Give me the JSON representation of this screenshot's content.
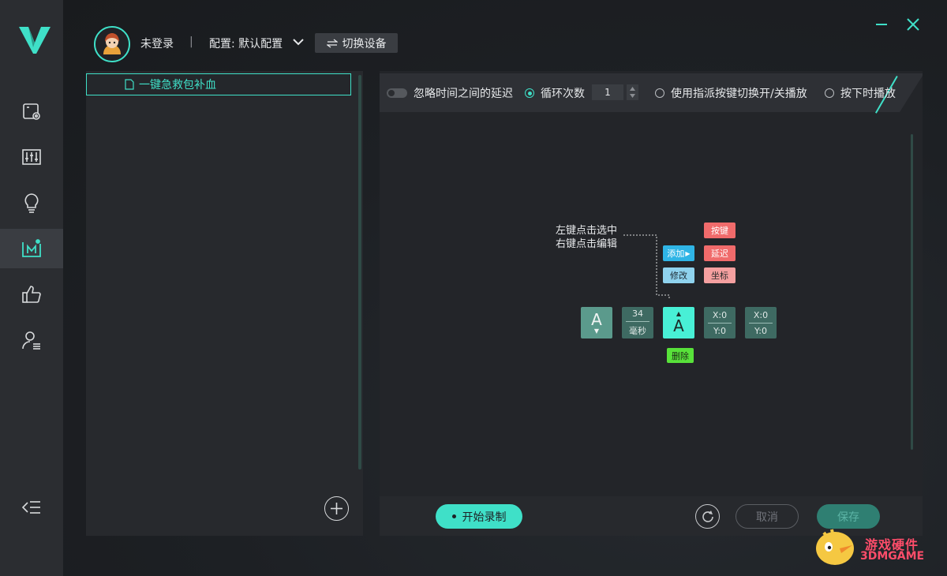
{
  "header": {
    "user_status": "未登录",
    "separator": "|",
    "config_label": "配置: 默认配置",
    "switch_device": "切换设备"
  },
  "macros": {
    "items": [
      {
        "label": "一键急救包补血"
      }
    ]
  },
  "options": {
    "ignore_delay": "忽略时间之间的延迟",
    "loop_count_label": "循环次数",
    "loop_count_value": "1",
    "toggle_by_key": "使用指派按键切换开/关播放",
    "play_while_pressed": "按下时播放"
  },
  "tutorial": {
    "hint_line1": "左键点击选中",
    "hint_line2": "右键点击编辑",
    "menu": {
      "add": "添加",
      "modify": "修改",
      "key": "按键",
      "delay": "延迟",
      "coord": "坐标",
      "delete": "删除"
    },
    "steps": {
      "key1": "A",
      "delay_value": "34",
      "delay_unit": "毫秒",
      "key2": "A",
      "coord1_x": "X:0",
      "coord1_y": "Y:0",
      "coord2_x": "X:0",
      "coord2_y": "Y:0"
    }
  },
  "footer": {
    "record": "开始录制",
    "cancel": "取消",
    "save": "保存"
  },
  "watermark": {
    "line1": "游戏硬件",
    "line2": "3DMGAME"
  },
  "colors": {
    "accent": "#3fe0c8",
    "sidebar_bg": "#2b2d31",
    "panel_bg": "#27292d"
  }
}
